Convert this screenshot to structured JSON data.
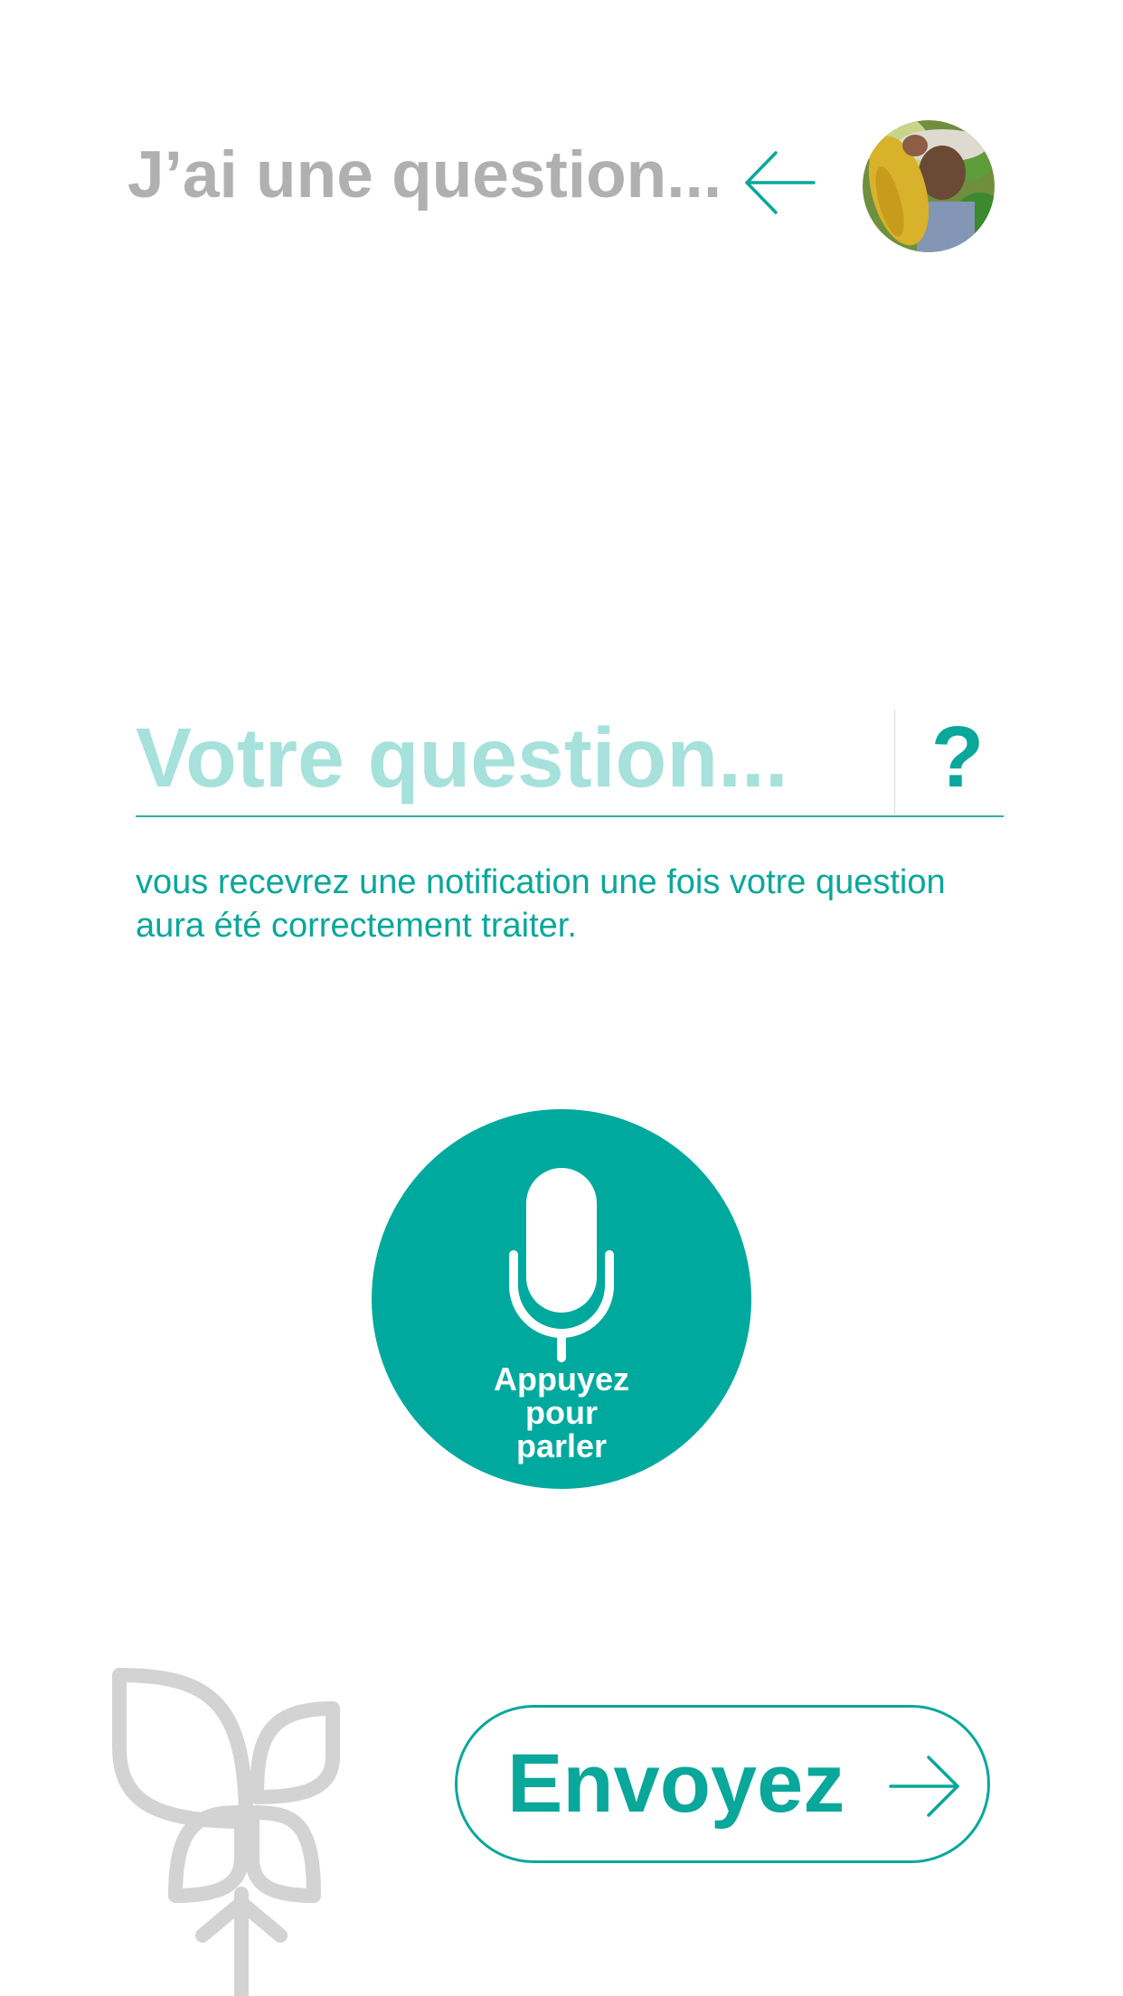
{
  "header": {
    "title": "J’ai une question...",
    "back_icon": "arrow-left-icon"
  },
  "question": {
    "placeholder": "Votre question...",
    "help_label": "?"
  },
  "notice": "vous recevrez une notification une fois votre question aura été correctement traiter.",
  "microphone": {
    "icon": "microphone-icon",
    "label_line1": "Appuyez",
    "label_line2": "pour",
    "label_line3": "parler"
  },
  "send": {
    "label": "Envoyez",
    "icon": "arrow-right-icon"
  },
  "colors": {
    "accent": "#00a99d",
    "accent_text": "#0aa79b",
    "placeholder": "#a6e1dc",
    "title_gray": "#b0b0b0",
    "logo_gray": "#d3d3d3"
  }
}
